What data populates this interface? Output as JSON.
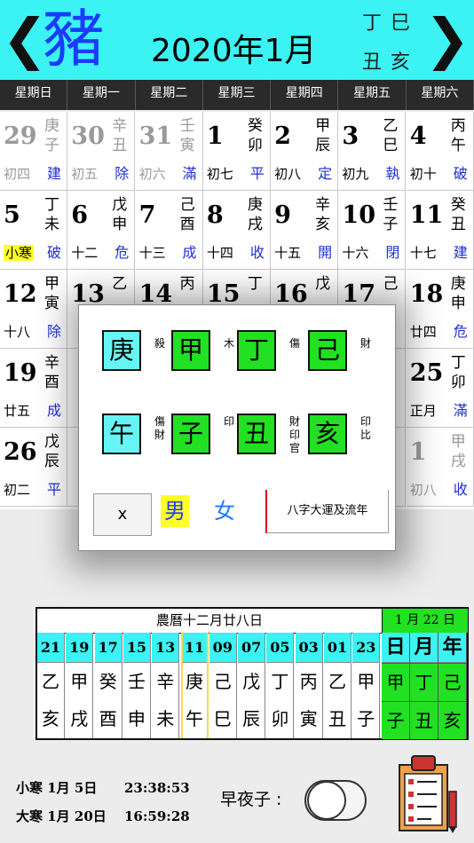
{
  "header": {
    "zodiac": "豬",
    "month_title": "2020年1月",
    "year_ganzhi": "丁巳",
    "month_ganzhi": "丑亥",
    "prev": "❮",
    "next": "❯"
  },
  "weekdays": [
    "星期日",
    "星期一",
    "星期二",
    "星期三",
    "星期四",
    "星期五",
    "星期六"
  ],
  "calendar": [
    [
      {
        "day": "29",
        "gan": "庚",
        "zhi": "子",
        "lunar": "初四",
        "duty": "建",
        "grey": true
      },
      {
        "day": "30",
        "gan": "辛",
        "zhi": "丑",
        "lunar": "初五",
        "duty": "除",
        "grey": true
      },
      {
        "day": "31",
        "gan": "壬",
        "zhi": "寅",
        "lunar": "初六",
        "duty": "滿",
        "grey": true
      },
      {
        "day": "1",
        "gan": "癸",
        "zhi": "卯",
        "lunar": "初七",
        "duty": "平"
      },
      {
        "day": "2",
        "gan": "甲",
        "zhi": "辰",
        "lunar": "初八",
        "duty": "定"
      },
      {
        "day": "3",
        "gan": "乙",
        "zhi": "巳",
        "lunar": "初九",
        "duty": "執"
      },
      {
        "day": "4",
        "gan": "丙",
        "zhi": "午",
        "lunar": "初十",
        "duty": "破"
      }
    ],
    [
      {
        "day": "5",
        "gan": "丁",
        "zhi": "未",
        "lunar": "小寒",
        "duty": "破",
        "term": true
      },
      {
        "day": "6",
        "gan": "戊",
        "zhi": "申",
        "lunar": "十二",
        "duty": "危"
      },
      {
        "day": "7",
        "gan": "己",
        "zhi": "酉",
        "lunar": "十三",
        "duty": "成"
      },
      {
        "day": "8",
        "gan": "庚",
        "zhi": "戌",
        "lunar": "十四",
        "duty": "收"
      },
      {
        "day": "9",
        "gan": "辛",
        "zhi": "亥",
        "lunar": "十五",
        "duty": "開"
      },
      {
        "day": "10",
        "gan": "壬",
        "zhi": "子",
        "lunar": "十六",
        "duty": "閉"
      },
      {
        "day": "11",
        "gan": "癸",
        "zhi": "丑",
        "lunar": "十七",
        "duty": "建"
      }
    ],
    [
      {
        "day": "12",
        "gan": "甲",
        "zhi": "寅",
        "lunar": "十八",
        "duty": "除"
      },
      {
        "day": "13",
        "gan": "乙",
        "zhi": "",
        "lunar": "",
        "duty": ""
      },
      {
        "day": "14",
        "gan": "丙",
        "zhi": "",
        "lunar": "",
        "duty": ""
      },
      {
        "day": "15",
        "gan": "丁",
        "zhi": "",
        "lunar": "",
        "duty": ""
      },
      {
        "day": "16",
        "gan": "戊",
        "zhi": "",
        "lunar": "",
        "duty": ""
      },
      {
        "day": "17",
        "gan": "己",
        "zhi": "",
        "lunar": "",
        "duty": ""
      },
      {
        "day": "18",
        "gan": "庚",
        "zhi": "申",
        "lunar": "廿四",
        "duty": "危"
      }
    ],
    [
      {
        "day": "19",
        "gan": "辛",
        "zhi": "酉",
        "lunar": "廿五",
        "duty": "成"
      },
      {
        "day": "",
        "gan": "",
        "zhi": "",
        "lunar": "",
        "duty": ""
      },
      {
        "day": "",
        "gan": "",
        "zhi": "",
        "lunar": "",
        "duty": ""
      },
      {
        "day": "",
        "gan": "",
        "zhi": "",
        "lunar": "",
        "duty": ""
      },
      {
        "day": "",
        "gan": "",
        "zhi": "",
        "lunar": "",
        "duty": ""
      },
      {
        "day": "",
        "gan": "",
        "zhi": "",
        "lunar": "",
        "duty": ""
      },
      {
        "day": "25",
        "gan": "丁",
        "zhi": "卯",
        "lunar": "正月",
        "duty": "滿"
      }
    ],
    [
      {
        "day": "26",
        "gan": "戊",
        "zhi": "辰",
        "lunar": "初二",
        "duty": "平"
      },
      {
        "day": "",
        "gan": "",
        "zhi": "",
        "lunar": "",
        "duty": ""
      },
      {
        "day": "",
        "gan": "",
        "zhi": "",
        "lunar": "",
        "duty": ""
      },
      {
        "day": "",
        "gan": "",
        "zhi": "",
        "lunar": "",
        "duty": ""
      },
      {
        "day": "",
        "gan": "",
        "zhi": "",
        "lunar": "",
        "duty": ""
      },
      {
        "day": "",
        "gan": "",
        "zhi": "",
        "lunar": "",
        "duty": ""
      },
      {
        "day": "1",
        "gan": "甲",
        "zhi": "戌",
        "lunar": "初八",
        "duty": "收",
        "grey": true
      }
    ]
  ],
  "popup": {
    "stems": [
      {
        "char": "庚",
        "god": "殺",
        "style": "cy"
      },
      {
        "char": "甲",
        "god": "木",
        "style": "gr"
      },
      {
        "char": "丁",
        "god": "傷",
        "style": "gr"
      },
      {
        "char": "己",
        "god": "財",
        "style": "gr"
      }
    ],
    "branches": [
      {
        "char": "午",
        "god": "傷財",
        "style": "cy"
      },
      {
        "char": "子",
        "god": "印",
        "style": "gr"
      },
      {
        "char": "丑",
        "god": "財印官",
        "style": "gr"
      },
      {
        "char": "亥",
        "god": "印比",
        "style": "gr"
      }
    ],
    "close_label": "x",
    "male_label": "男",
    "female_label": "女",
    "bazi_label": "八字大運及流年"
  },
  "table": {
    "lunar_date": "農曆十二月廿八日",
    "solar_date": "1 月 22 日",
    "hours": [
      {
        "h": "21",
        "gan": "乙",
        "zhi": "亥"
      },
      {
        "h": "19",
        "gan": "甲",
        "zhi": "戌"
      },
      {
        "h": "17",
        "gan": "癸",
        "zhi": "酉"
      },
      {
        "h": "15",
        "gan": "壬",
        "zhi": "申"
      },
      {
        "h": "13",
        "gan": "辛",
        "zhi": "未"
      },
      {
        "h": "11",
        "gan": "庚",
        "zhi": "午",
        "selected": true
      },
      {
        "h": "09",
        "gan": "己",
        "zhi": "巳"
      },
      {
        "h": "07",
        "gan": "戊",
        "zhi": "辰"
      },
      {
        "h": "05",
        "gan": "丁",
        "zhi": "卯"
      },
      {
        "h": "03",
        "gan": "丙",
        "zhi": "寅"
      },
      {
        "h": "01",
        "gan": "乙",
        "zhi": "丑"
      },
      {
        "h": "23",
        "gan": "甲",
        "zhi": "子"
      }
    ],
    "pillars": [
      {
        "label": "日",
        "gan": "甲",
        "zhi": "子"
      },
      {
        "label": "月",
        "gan": "丁",
        "zhi": "丑"
      },
      {
        "label": "年",
        "gan": "己",
        "zhi": "亥"
      }
    ]
  },
  "footer": {
    "term1_name": "小寒 1月 5日",
    "term1_time": "23:38:53",
    "term2_name": "大寒 1月 20日",
    "term2_time": "16:59:28",
    "zaozi_label": "早夜子 :"
  }
}
